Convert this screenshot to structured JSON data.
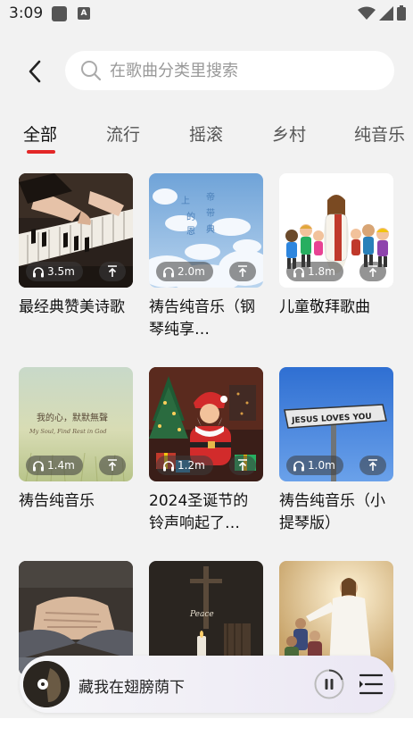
{
  "status": {
    "time": "3:09",
    "notification_badge": "A"
  },
  "search": {
    "placeholder": "在歌曲分类里搜索"
  },
  "tabs": [
    {
      "label": "全部",
      "active": true
    },
    {
      "label": "流行"
    },
    {
      "label": "摇滚"
    },
    {
      "label": "乡村"
    },
    {
      "label": "纯音乐"
    }
  ],
  "cards": [
    {
      "title": "最经典赞美诗歌",
      "plays": "3.5m",
      "art": "piano"
    },
    {
      "title": "祷告纯音乐（钢琴纯享…",
      "plays": "2.0m",
      "art": "clouds",
      "art_text": [
        "上",
        "帝",
        "的",
        "带",
        "恩",
        "典"
      ]
    },
    {
      "title": "儿童敬拜歌曲",
      "plays": "1.8m",
      "art": "kids"
    },
    {
      "title": "祷告纯音乐",
      "plays": "1.4m",
      "art": "field",
      "art_text": [
        "我的心，默默無聲",
        "My Soul, Find Rest in God"
      ]
    },
    {
      "title": "2024圣诞节的铃声响起了…",
      "plays": "1.2m",
      "art": "santa"
    },
    {
      "title": "祷告纯音乐（小提琴版）",
      "plays": "1.0m",
      "art": "sign",
      "art_text": [
        "JESUS LOVES YOU"
      ]
    },
    {
      "title": "",
      "plays": "",
      "art": "hands"
    },
    {
      "title": "",
      "plays": "",
      "art": "cross",
      "art_text": [
        "Peace"
      ]
    },
    {
      "title": "",
      "plays": "",
      "art": "jesus"
    }
  ],
  "player": {
    "title": "藏我在翅膀荫下"
  },
  "colors": {
    "accent": "#e32727",
    "background": "#f2f2f2"
  }
}
